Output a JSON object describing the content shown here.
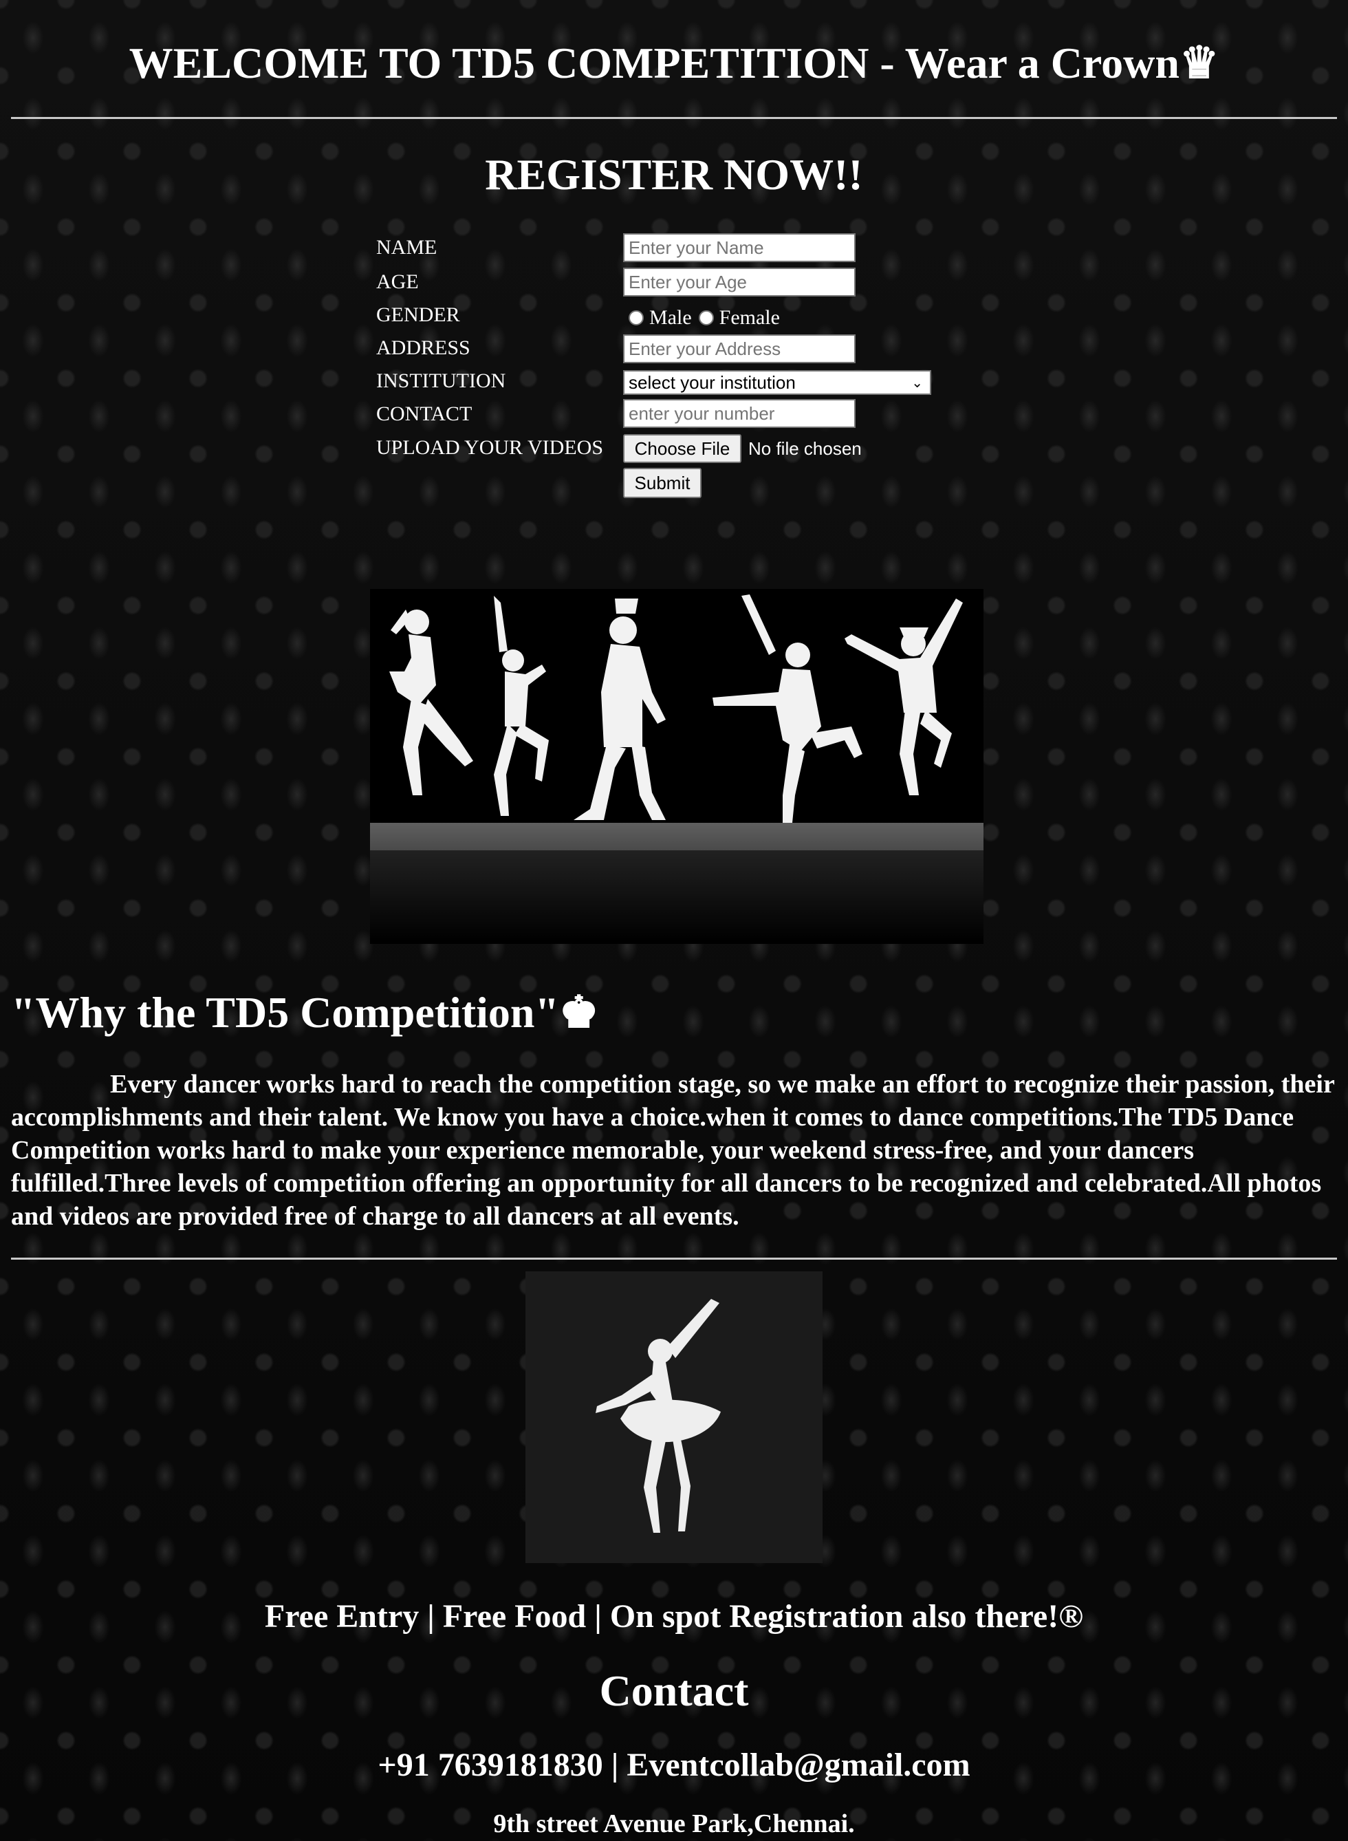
{
  "header": {
    "title": "WELCOME TO TD5 COMPETITION - Wear a Crown♛"
  },
  "register": {
    "heading": "REGISTER NOW!!",
    "fields": {
      "name_label": "NAME",
      "name_placeholder": "Enter your Name",
      "age_label": "AGE",
      "age_placeholder": "Enter your Age",
      "gender_label": "GENDER",
      "gender_male": "Male",
      "gender_female": "Female",
      "address_label": "ADDRESS",
      "address_placeholder": "Enter your Address",
      "institution_label": "INSTITUTION",
      "institution_selected": "select your institution",
      "contact_label": "CONTACT",
      "contact_placeholder": "enter your number",
      "upload_label": "UPLOAD YOUR VIDEOS",
      "choose_file": "Choose File",
      "no_file": "No file chosen",
      "submit": "Submit"
    }
  },
  "why": {
    "heading": "\"Why the TD5 Competition\"♚",
    "paragraph": "Every dancer works hard to reach the competition stage, so we make an effort to recognize their passion, their accomplishments and their talent. We know you have a choice.when it comes to dance competitions.The TD5 Dance Competition works hard to make your experience memorable, your weekend stress-free, and your dancers fulfilled.Three levels of competition offering an opportunity for all dancers to be recognized and celebrated.All photos and videos are provided free of charge to all dancers at all events."
  },
  "footer": {
    "tagline": "Free Entry | Free Food | On spot Registration also there!®",
    "contact_heading": "Contact",
    "contact_info": "+91 7639181830 | Eventcollab@gmail.com",
    "address": "9th street Avenue Park,Chennai."
  },
  "images": {
    "dancers": "dancers-silhouette-image",
    "ballerina": "ballerina-silhouette-image"
  },
  "colors": {
    "background": "#0b0b0b",
    "text": "#ffffff",
    "rule": "#c8c8c8"
  }
}
